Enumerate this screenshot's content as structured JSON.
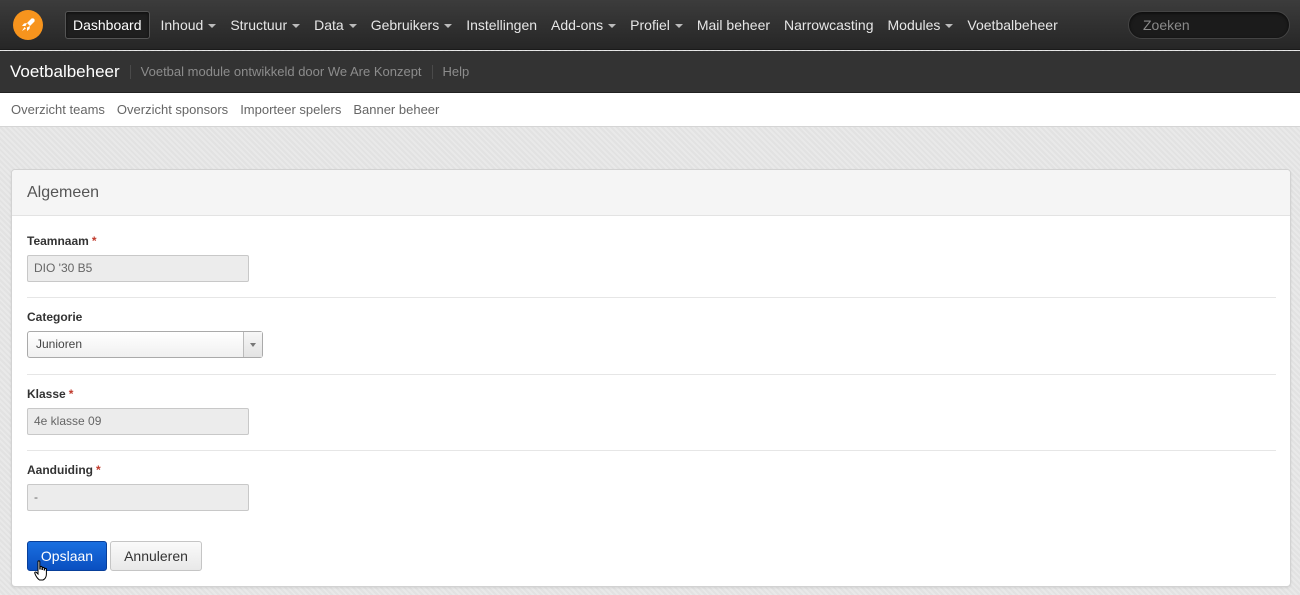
{
  "topnav": {
    "items": [
      {
        "label": "Dashboard",
        "active": true,
        "dropdown": false
      },
      {
        "label": "Inhoud",
        "dropdown": true
      },
      {
        "label": "Structuur",
        "dropdown": true
      },
      {
        "label": "Data",
        "dropdown": true
      },
      {
        "label": "Gebruikers",
        "dropdown": true
      },
      {
        "label": "Instellingen",
        "dropdown": false
      },
      {
        "label": "Add-ons",
        "dropdown": true
      },
      {
        "label": "Profiel",
        "dropdown": true
      },
      {
        "label": "Mail beheer",
        "dropdown": false
      },
      {
        "label": "Narrowcasting",
        "dropdown": false
      },
      {
        "label": "Modules",
        "dropdown": true
      },
      {
        "label": "Voetbalbeheer",
        "dropdown": false
      }
    ],
    "search_placeholder": "Zoeken",
    "accent": "#f7941d"
  },
  "module": {
    "title": "Voetbalbeheer",
    "description": "Voetbal module ontwikkeld door We Are Konzept",
    "help": "Help"
  },
  "tabs": [
    "Overzicht teams",
    "Overzicht sponsors",
    "Importeer spelers",
    "Banner beheer"
  ],
  "panel": {
    "title": "Algemeen",
    "fields": {
      "teamnaam": {
        "label": "Teamnaam",
        "required": "*",
        "value": "DIO '30 B5"
      },
      "categorie": {
        "label": "Categorie",
        "value": "Junioren"
      },
      "klasse": {
        "label": "Klasse",
        "required": "*",
        "value": "4e klasse 09"
      },
      "aanduiding": {
        "label": "Aanduiding",
        "required": "*",
        "value": "-"
      }
    },
    "save_label": "Opslaan",
    "cancel_label": "Annuleren"
  }
}
